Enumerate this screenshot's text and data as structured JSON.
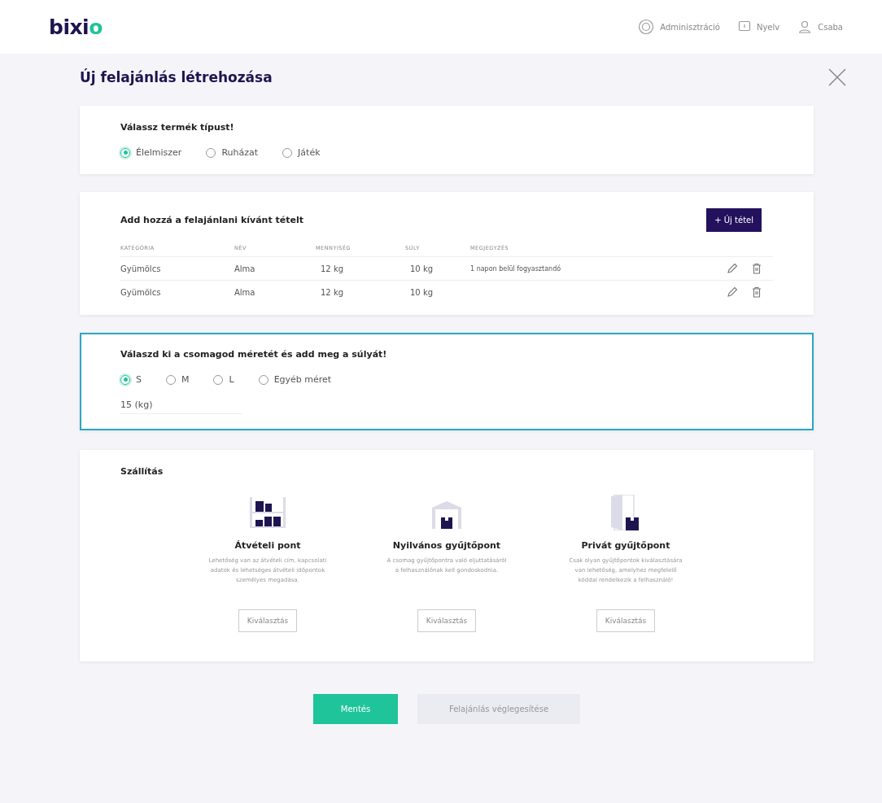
{
  "header": {
    "logo": "bixio",
    "nav": [
      {
        "kind": "admin",
        "label": "Adminisztráció"
      },
      {
        "kind": "language",
        "label": "Nyelv"
      },
      {
        "kind": "user",
        "label": "Csaba"
      }
    ]
  },
  "dialog": {
    "title": "Új felajánlás létrehozása"
  },
  "product_type": {
    "title": "Válassz termék típust!",
    "options": [
      {
        "label": "Élelmiszer",
        "selected": true
      },
      {
        "label": "Ruházat",
        "selected": false
      },
      {
        "label": "Játék",
        "selected": false
      }
    ]
  },
  "items": {
    "title": "Add hozzá a felajánlani kívánt tételt",
    "add_button": "+ Új tétel",
    "columns": [
      "KATEGÓRIA",
      "NÉV",
      "MENNYISÉG",
      "SÚLY",
      "MEGJEGYZÉS"
    ],
    "rows": [
      {
        "cells": [
          "Gyümölcs",
          "Alma",
          "12 kg",
          "10 kg",
          "1 napon belül fogyasztandó"
        ]
      },
      {
        "cells": [
          "Gyümölcs",
          "Alma",
          "12 kg",
          "10 kg",
          ""
        ]
      }
    ]
  },
  "package": {
    "title": "Válaszd ki a csomagod méretét és add meg a súlyát!",
    "focused": true,
    "options": [
      {
        "label": "S",
        "selected": true
      },
      {
        "label": "M",
        "selected": false
      },
      {
        "label": "L",
        "selected": false
      },
      {
        "label": "Egyéb méret",
        "selected": false
      }
    ],
    "weight": {
      "value": "15 (kg)"
    }
  },
  "delivery": {
    "title": "Szállítás",
    "options": [
      {
        "kind": "shelf",
        "title": "Átvételi pont",
        "description": "Lehetőség van az átvételi cím, kapcsolati adatok és lehetséges átvételi időpontok személyes megadása.",
        "button": "Kiválasztás"
      },
      {
        "kind": "warehouse",
        "title": "Nyilvános gyűjtőpont",
        "description": "A csomag gyűjtőpontra való eljuttatásáról a felhasználónak kell gondoskodnia.",
        "button": "Kiválasztás"
      },
      {
        "kind": "door",
        "title": "Privát gyűjtőpont",
        "description": "Csak olyan gyűjtőpontok kiválasztására van lehetőség, amelyhez megfelelő kóddal rendelkezik a felhasználó!",
        "button": "Kiválasztás"
      }
    ]
  },
  "actions": [
    {
      "label": "Mentés",
      "disabled": false
    },
    {
      "label": "Felajánlás véglegesítése",
      "disabled": true
    }
  ]
}
